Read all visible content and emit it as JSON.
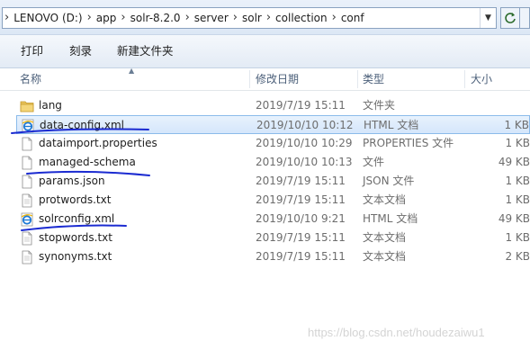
{
  "address_bar": {
    "breadcrumbs": [
      "LENOVO (D:)",
      "app",
      "solr-8.2.0",
      "server",
      "solr",
      "collection",
      "conf"
    ]
  },
  "toolbar": {
    "print_label": "打印",
    "burn_label": "刻录",
    "new_folder_label": "新建文件夹"
  },
  "columns": {
    "name": "名称",
    "date": "修改日期",
    "type": "类型",
    "size": "大小"
  },
  "files": [
    {
      "name": "lang",
      "date": "2019/7/19 15:11",
      "type": "文件夹",
      "size": "",
      "icon": "folder-icon"
    },
    {
      "name": "data-config.xml",
      "date": "2019/10/10 10:12",
      "type": "HTML 文档",
      "size": "1 KB",
      "icon": "ie-icon",
      "selected": true
    },
    {
      "name": "dataimport.properties",
      "date": "2019/10/10 10:29",
      "type": "PROPERTIES 文件",
      "size": "1 KB",
      "icon": "file-icon"
    },
    {
      "name": "managed-schema",
      "date": "2019/10/10 10:13",
      "type": "文件",
      "size": "49 KB",
      "icon": "file-icon"
    },
    {
      "name": "params.json",
      "date": "2019/7/19 15:11",
      "type": "JSON 文件",
      "size": "1 KB",
      "icon": "file-icon"
    },
    {
      "name": "protwords.txt",
      "date": "2019/7/19 15:11",
      "type": "文本文档",
      "size": "1 KB",
      "icon": "file-icon"
    },
    {
      "name": "solrconfig.xml",
      "date": "2019/10/10 9:21",
      "type": "HTML 文档",
      "size": "49 KB",
      "icon": "ie-icon"
    },
    {
      "name": "stopwords.txt",
      "date": "2019/7/19 15:11",
      "type": "文本文档",
      "size": "1 KB",
      "icon": "file-icon"
    },
    {
      "name": "synonyms.txt",
      "date": "2019/7/19 15:11",
      "type": "文本文档",
      "size": "2 KB",
      "icon": "file-icon"
    }
  ],
  "colors": {
    "selection_bg": "#d5e6fb",
    "selection_border": "#8bbbea",
    "annotation_ink": "#1b2bd1",
    "folder": "#e8c25a"
  },
  "watermark": "https://blog.csdn.net/houdezaiwu1"
}
